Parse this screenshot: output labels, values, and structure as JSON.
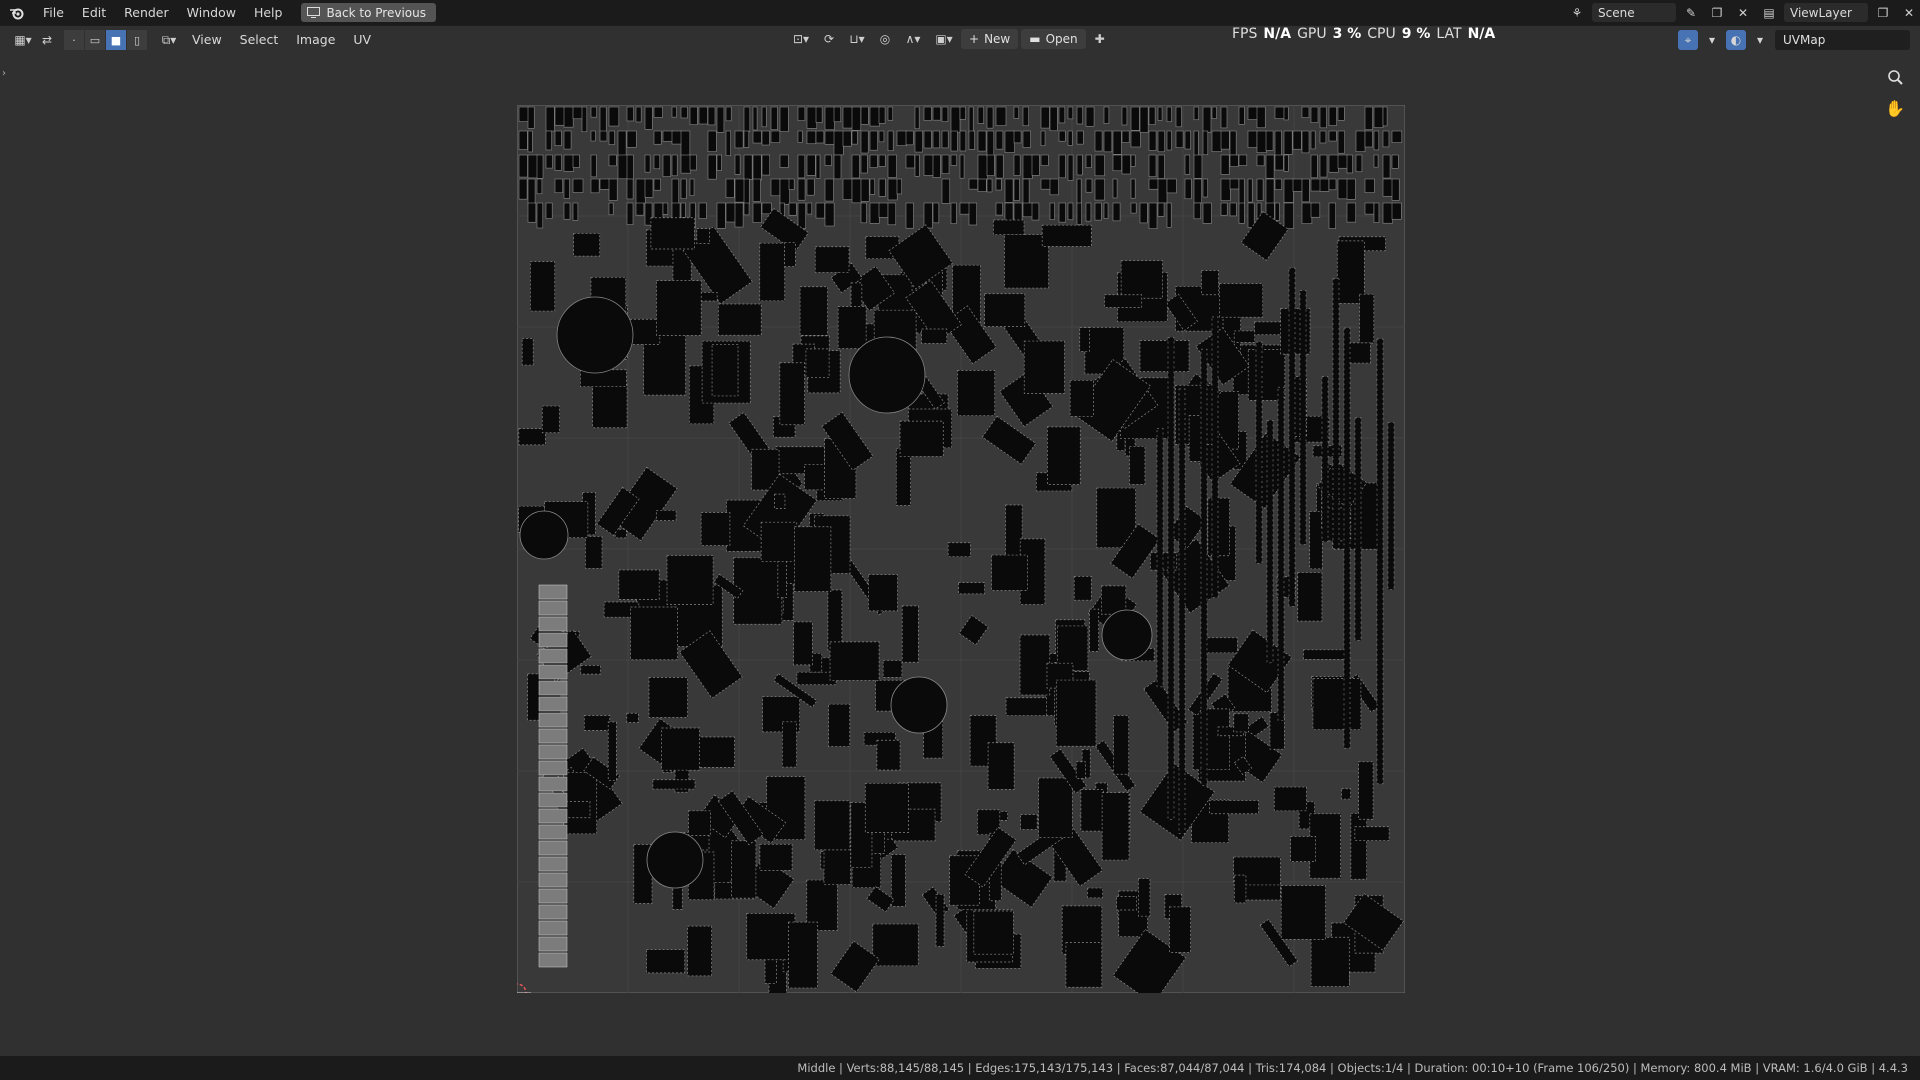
{
  "menubar": {
    "items": [
      "File",
      "Edit",
      "Render",
      "Window",
      "Help"
    ],
    "back_button": "Back to Previous",
    "scene": "Scene",
    "view_layer": "ViewLayer"
  },
  "editor": {
    "menus": [
      "View",
      "Select",
      "Image",
      "UV"
    ],
    "new_button": "New",
    "open_button": "Open",
    "uvmap": "UVMap"
  },
  "perf": {
    "fps_label": "FPS",
    "fps_value": "N/A",
    "gpu_label": "GPU",
    "gpu_value": "3 %",
    "cpu_label": "CPU",
    "cpu_value": "9 %",
    "lat_label": "LAT",
    "lat_value": "N/A"
  },
  "statusbar": {
    "text": "Middle | Verts:88,145/88,145 | Edges:175,143/175,143 | Faces:87,044/87,044 | Tris:174,084 | Objects:1/4 | Duration: 00:10+10 (Frame 106/250) | Memory: 800.4 MiB | VRAM: 1.6/4.0 GiB | 4.4.3"
  },
  "colors": {
    "header": "#303030",
    "viewport": "#303030",
    "uv_bg": "#393939",
    "island_fill": "#0a0a0a",
    "island_edge": "#8a8a8a",
    "accent": "#4772b3"
  }
}
